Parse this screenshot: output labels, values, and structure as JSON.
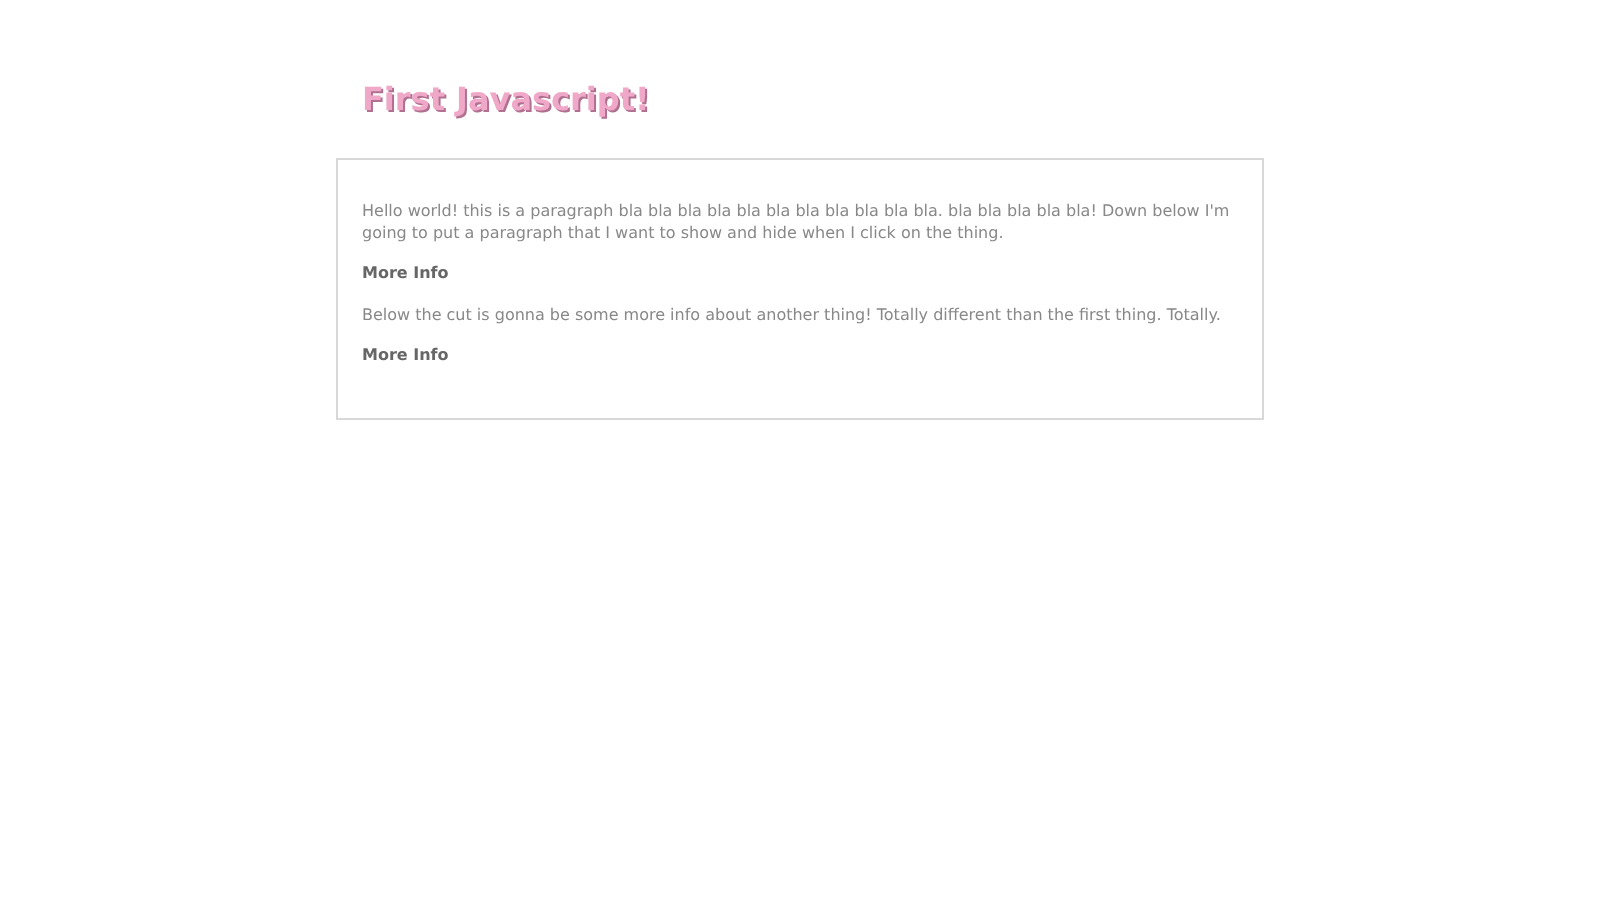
{
  "title": "First Javascript!",
  "sections": [
    {
      "text": "Hello world! this is a paragraph bla bla bla bla bla bla bla bla bla bla bla. bla bla bla bla bla! Down below I'm going to put a paragraph that I want to show and hide when I click on the thing.",
      "link": "More Info"
    },
    {
      "text": "Below the cut is gonna be some more info about another thing! Totally different than the first thing. Totally.",
      "link": "More Info"
    }
  ]
}
